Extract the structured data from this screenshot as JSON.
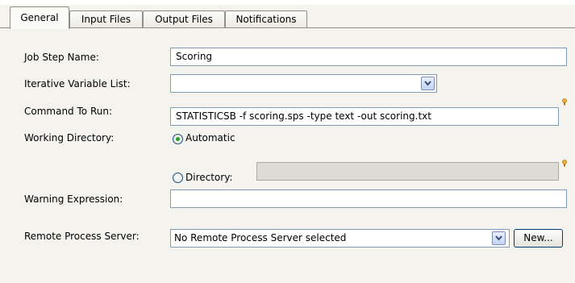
{
  "tabs": [
    {
      "label": "General",
      "active": true
    },
    {
      "label": "Input Files",
      "active": false
    },
    {
      "label": "Output Files",
      "active": false
    },
    {
      "label": "Notifications",
      "active": false
    }
  ],
  "form": {
    "job_step_name": {
      "label": "Job Step Name:",
      "value": "Scoring"
    },
    "iterative_variable_list": {
      "label": "Iterative Variable List:",
      "value": ""
    },
    "command_to_run": {
      "label": "Command To Run:",
      "value": "STATISTICSB -f scoring.sps -type text -out scoring.txt"
    },
    "working_directory": {
      "label": "Working Directory:",
      "options": [
        {
          "label": "Automatic",
          "selected": true
        },
        {
          "label": "Directory:",
          "selected": false
        }
      ],
      "directory_value": ""
    },
    "warning_expression": {
      "label": "Warning Expression:",
      "value": ""
    },
    "remote_process_server": {
      "label": "Remote Process Server:",
      "value": "No Remote Process Server selected",
      "new_button": "New..."
    }
  },
  "colors": {
    "panel_bg": "#f4f3ee",
    "field_border": "#7f9db9",
    "radio_dot": "#2aa02a",
    "bulb": "#f0b030"
  }
}
